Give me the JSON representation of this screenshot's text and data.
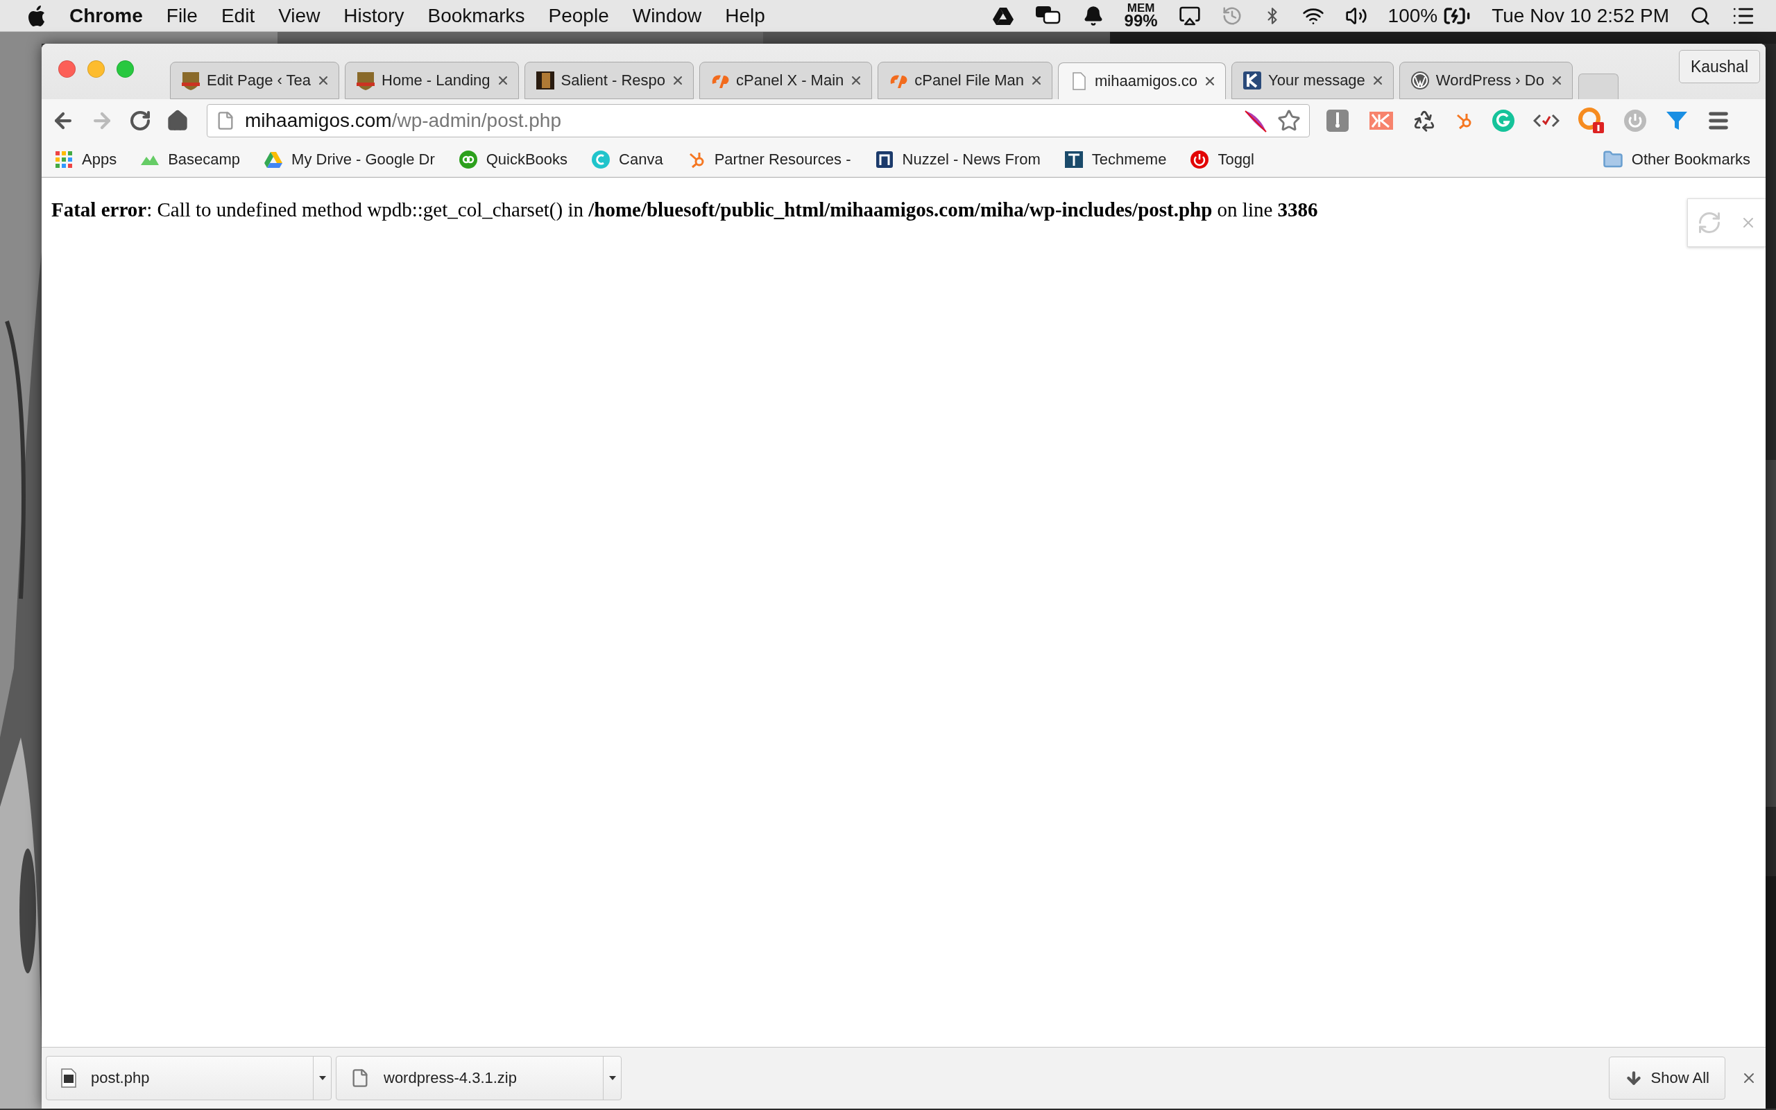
{
  "menu_bar": {
    "app": "Chrome",
    "menus": [
      "File",
      "Edit",
      "View",
      "History",
      "Bookmarks",
      "People",
      "Window",
      "Help"
    ],
    "memory_label": "MEM",
    "memory_value": "99%",
    "battery": "100%",
    "clock": "Tue Nov 10  2:52 PM"
  },
  "tabs": [
    {
      "title": "Edit Page ‹ Tea",
      "selected": false
    },
    {
      "title": "Home - Landing",
      "selected": false
    },
    {
      "title": "Salient - Respo",
      "selected": false
    },
    {
      "title": "cPanel X - Main",
      "selected": false
    },
    {
      "title": "cPanel File Man",
      "selected": false
    },
    {
      "title": "mihaamigos.co",
      "selected": true
    },
    {
      "title": "Your message",
      "selected": false
    },
    {
      "title": "WordPress › Do",
      "selected": false
    }
  ],
  "profile": "Kaushal",
  "address": {
    "host": "mihaamigos.com",
    "path": "/wp-admin/post.php"
  },
  "bookmarks": [
    {
      "label": "Apps"
    },
    {
      "label": "Basecamp"
    },
    {
      "label": "My Drive - Google Dr"
    },
    {
      "label": "QuickBooks"
    },
    {
      "label": "Canva"
    },
    {
      "label": "Partner Resources -"
    },
    {
      "label": "Nuzzel - News From"
    },
    {
      "label": "Techmeme"
    },
    {
      "label": "Toggl"
    }
  ],
  "other_bookmarks": "Other Bookmarks",
  "page": {
    "error": "**Fatal error**: Call to undefined method wpdb::get_col_charset() in **/home/bluesoft/public_html/mihaamigos.com/miha/wp-includes/post.php** on line **3386**"
  },
  "downloads": [
    {
      "filename": "post.php"
    },
    {
      "filename": "wordpress-4.3.1.zip"
    }
  ],
  "show_all": "Show All"
}
